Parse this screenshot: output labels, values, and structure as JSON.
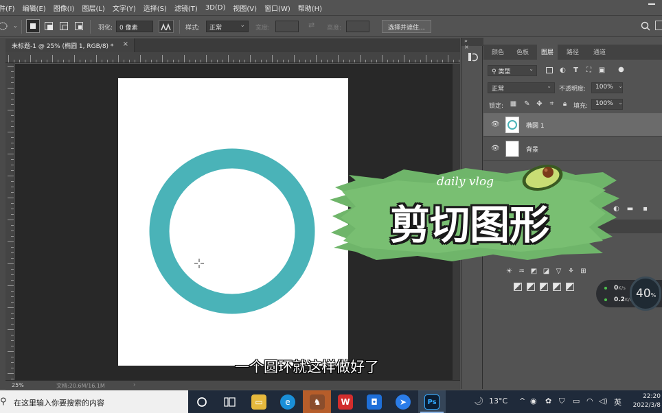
{
  "menu": [
    "件(F)",
    "编辑(E)",
    "图像(I)",
    "图层(L)",
    "文字(Y)",
    "选择(S)",
    "滤镜(T)",
    "3D(D)",
    "视图(V)",
    "窗口(W)",
    "帮助(H)"
  ],
  "options": {
    "feather_label": "羽化:",
    "feather_value": "0 像素",
    "style_label": "样式:",
    "style_value": "正常",
    "width_label": "宽度:",
    "height_label": "高度:",
    "select_mask_button": "选择并遮住..."
  },
  "document": {
    "tab_title": "未标题-1 @ 25% (椭圆 1, RGB/8) *",
    "close": "×",
    "zoom": "25%",
    "doc_size": "文档:20.6M/16.1M",
    "ring_color": "#4ab3b8"
  },
  "layers_panel": {
    "tabs": [
      "颜色",
      "色板",
      "图层",
      "路径",
      "通道"
    ],
    "active_tab": "图层",
    "filter_kind": "类型",
    "blend_mode": "正常",
    "opacity_label": "不透明度:",
    "opacity_value": "100%",
    "lock_label": "锁定:",
    "fill_label": "填充:",
    "fill_value": "100%",
    "layers": [
      {
        "name": "椭圆 1",
        "selected": true
      },
      {
        "name": "背景",
        "selected": false
      }
    ]
  },
  "overlay": {
    "sticker_small": "daily vlog",
    "sticker_title": "剪切图形",
    "subtitle": "一个圆环就这样做好了"
  },
  "netwidget": {
    "upload": "0",
    "upload_unit": "K/s",
    "download": "0.2",
    "download_unit": "K/s",
    "percent": "40",
    "percent_unit": "%"
  },
  "taskbar": {
    "search_placeholder": "在这里输入你要搜索的内容",
    "weather": "13°C",
    "ime": "英",
    "time": "22:20",
    "date": "2022/3/8"
  }
}
